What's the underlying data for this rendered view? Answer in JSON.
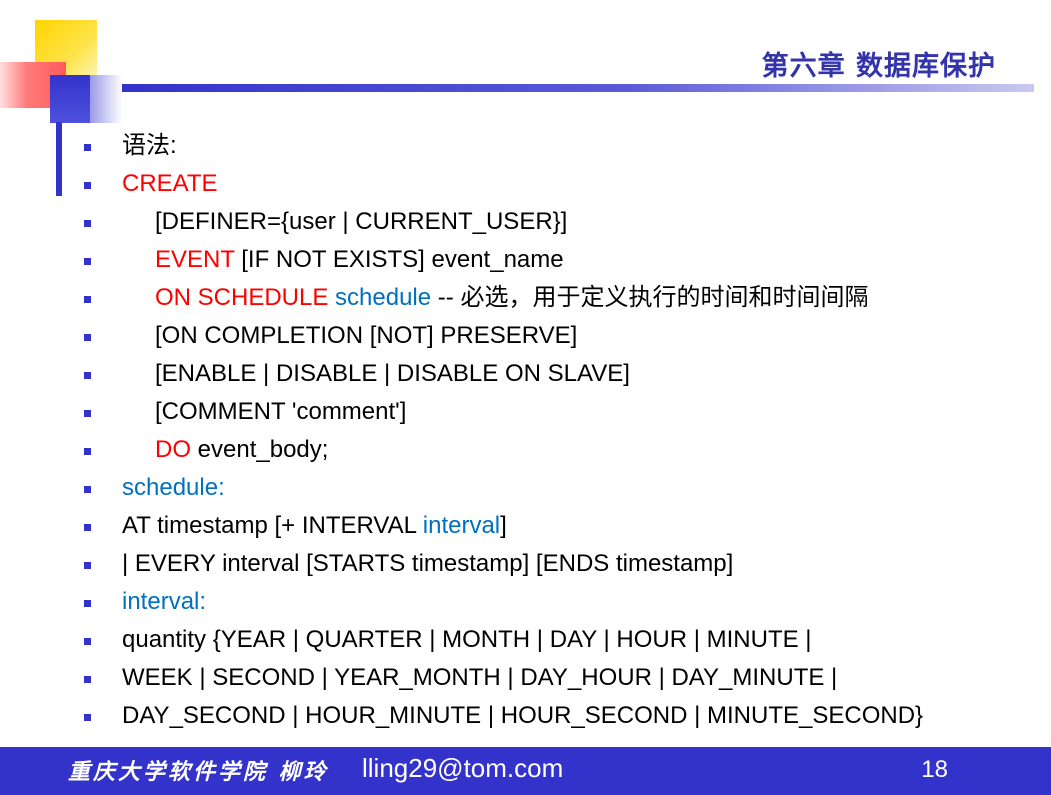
{
  "header": {
    "chapter_title": "第六章 数据库保护"
  },
  "lines": [
    {
      "segments": [
        {
          "t": "语法:",
          "c": ""
        }
      ],
      "indent": false
    },
    {
      "segments": [
        {
          "t": "CREATE",
          "c": "red"
        }
      ],
      "indent": false
    },
    {
      "segments": [
        {
          "t": "[DEFINER={user | CURRENT_USER}]",
          "c": ""
        }
      ],
      "indent": true
    },
    {
      "segments": [
        {
          "t": "EVENT",
          "c": "red"
        },
        {
          "t": " [IF NOT EXISTS] event_name",
          "c": ""
        }
      ],
      "indent": true
    },
    {
      "segments": [
        {
          "t": "ON SCHEDULE",
          "c": "red"
        },
        {
          "t": " schedule",
          "c": "blue"
        },
        {
          "t": "  -- 必选，用于定义执行的时间和时间间隔",
          "c": ""
        }
      ],
      "indent": true
    },
    {
      "segments": [
        {
          "t": "[ON COMPLETION [NOT] PRESERVE]",
          "c": ""
        }
      ],
      "indent": true
    },
    {
      "segments": [
        {
          "t": "[ENABLE | DISABLE | DISABLE ON SLAVE]",
          "c": ""
        }
      ],
      "indent": true
    },
    {
      "segments": [
        {
          "t": "[COMMENT 'comment']",
          "c": ""
        }
      ],
      "indent": true
    },
    {
      "segments": [
        {
          "t": "DO",
          "c": "red"
        },
        {
          "t": " event_body;",
          "c": ""
        }
      ],
      "indent": true
    },
    {
      "segments": [
        {
          "t": "schedule:",
          "c": "blue"
        }
      ],
      "indent": false
    },
    {
      "segments": [
        {
          "t": "AT timestamp [+ INTERVAL ",
          "c": ""
        },
        {
          "t": "interval",
          "c": "blue"
        },
        {
          "t": "]",
          "c": ""
        }
      ],
      "indent": false
    },
    {
      "segments": [
        {
          "t": "| EVERY interval [STARTS timestamp] [ENDS timestamp]",
          "c": ""
        }
      ],
      "indent": false
    },
    {
      "segments": [
        {
          "t": "interval:",
          "c": "blue"
        }
      ],
      "indent": false
    },
    {
      "segments": [
        {
          "t": "quantity {YEAR | QUARTER | MONTH | DAY | HOUR | MINUTE |",
          "c": ""
        }
      ],
      "indent": false
    },
    {
      "segments": [
        {
          "t": "WEEK | SECOND | YEAR_MONTH | DAY_HOUR | DAY_MINUTE |",
          "c": ""
        }
      ],
      "indent": false
    },
    {
      "segments": [
        {
          "t": "DAY_SECOND | HOUR_MINUTE | HOUR_SECOND | MINUTE_SECOND}",
          "c": ""
        }
      ],
      "indent": false
    }
  ],
  "footer": {
    "school_author": "重庆大学软件学院  柳玲",
    "email": "lling29@tom.com",
    "page_number": "18"
  },
  "colors": {
    "accent_blue": "#3333cc",
    "keyword_red": "#ff0000",
    "keyword_blue": "#0070c0"
  },
  "icons": [
    "square-bullet-icon"
  ]
}
